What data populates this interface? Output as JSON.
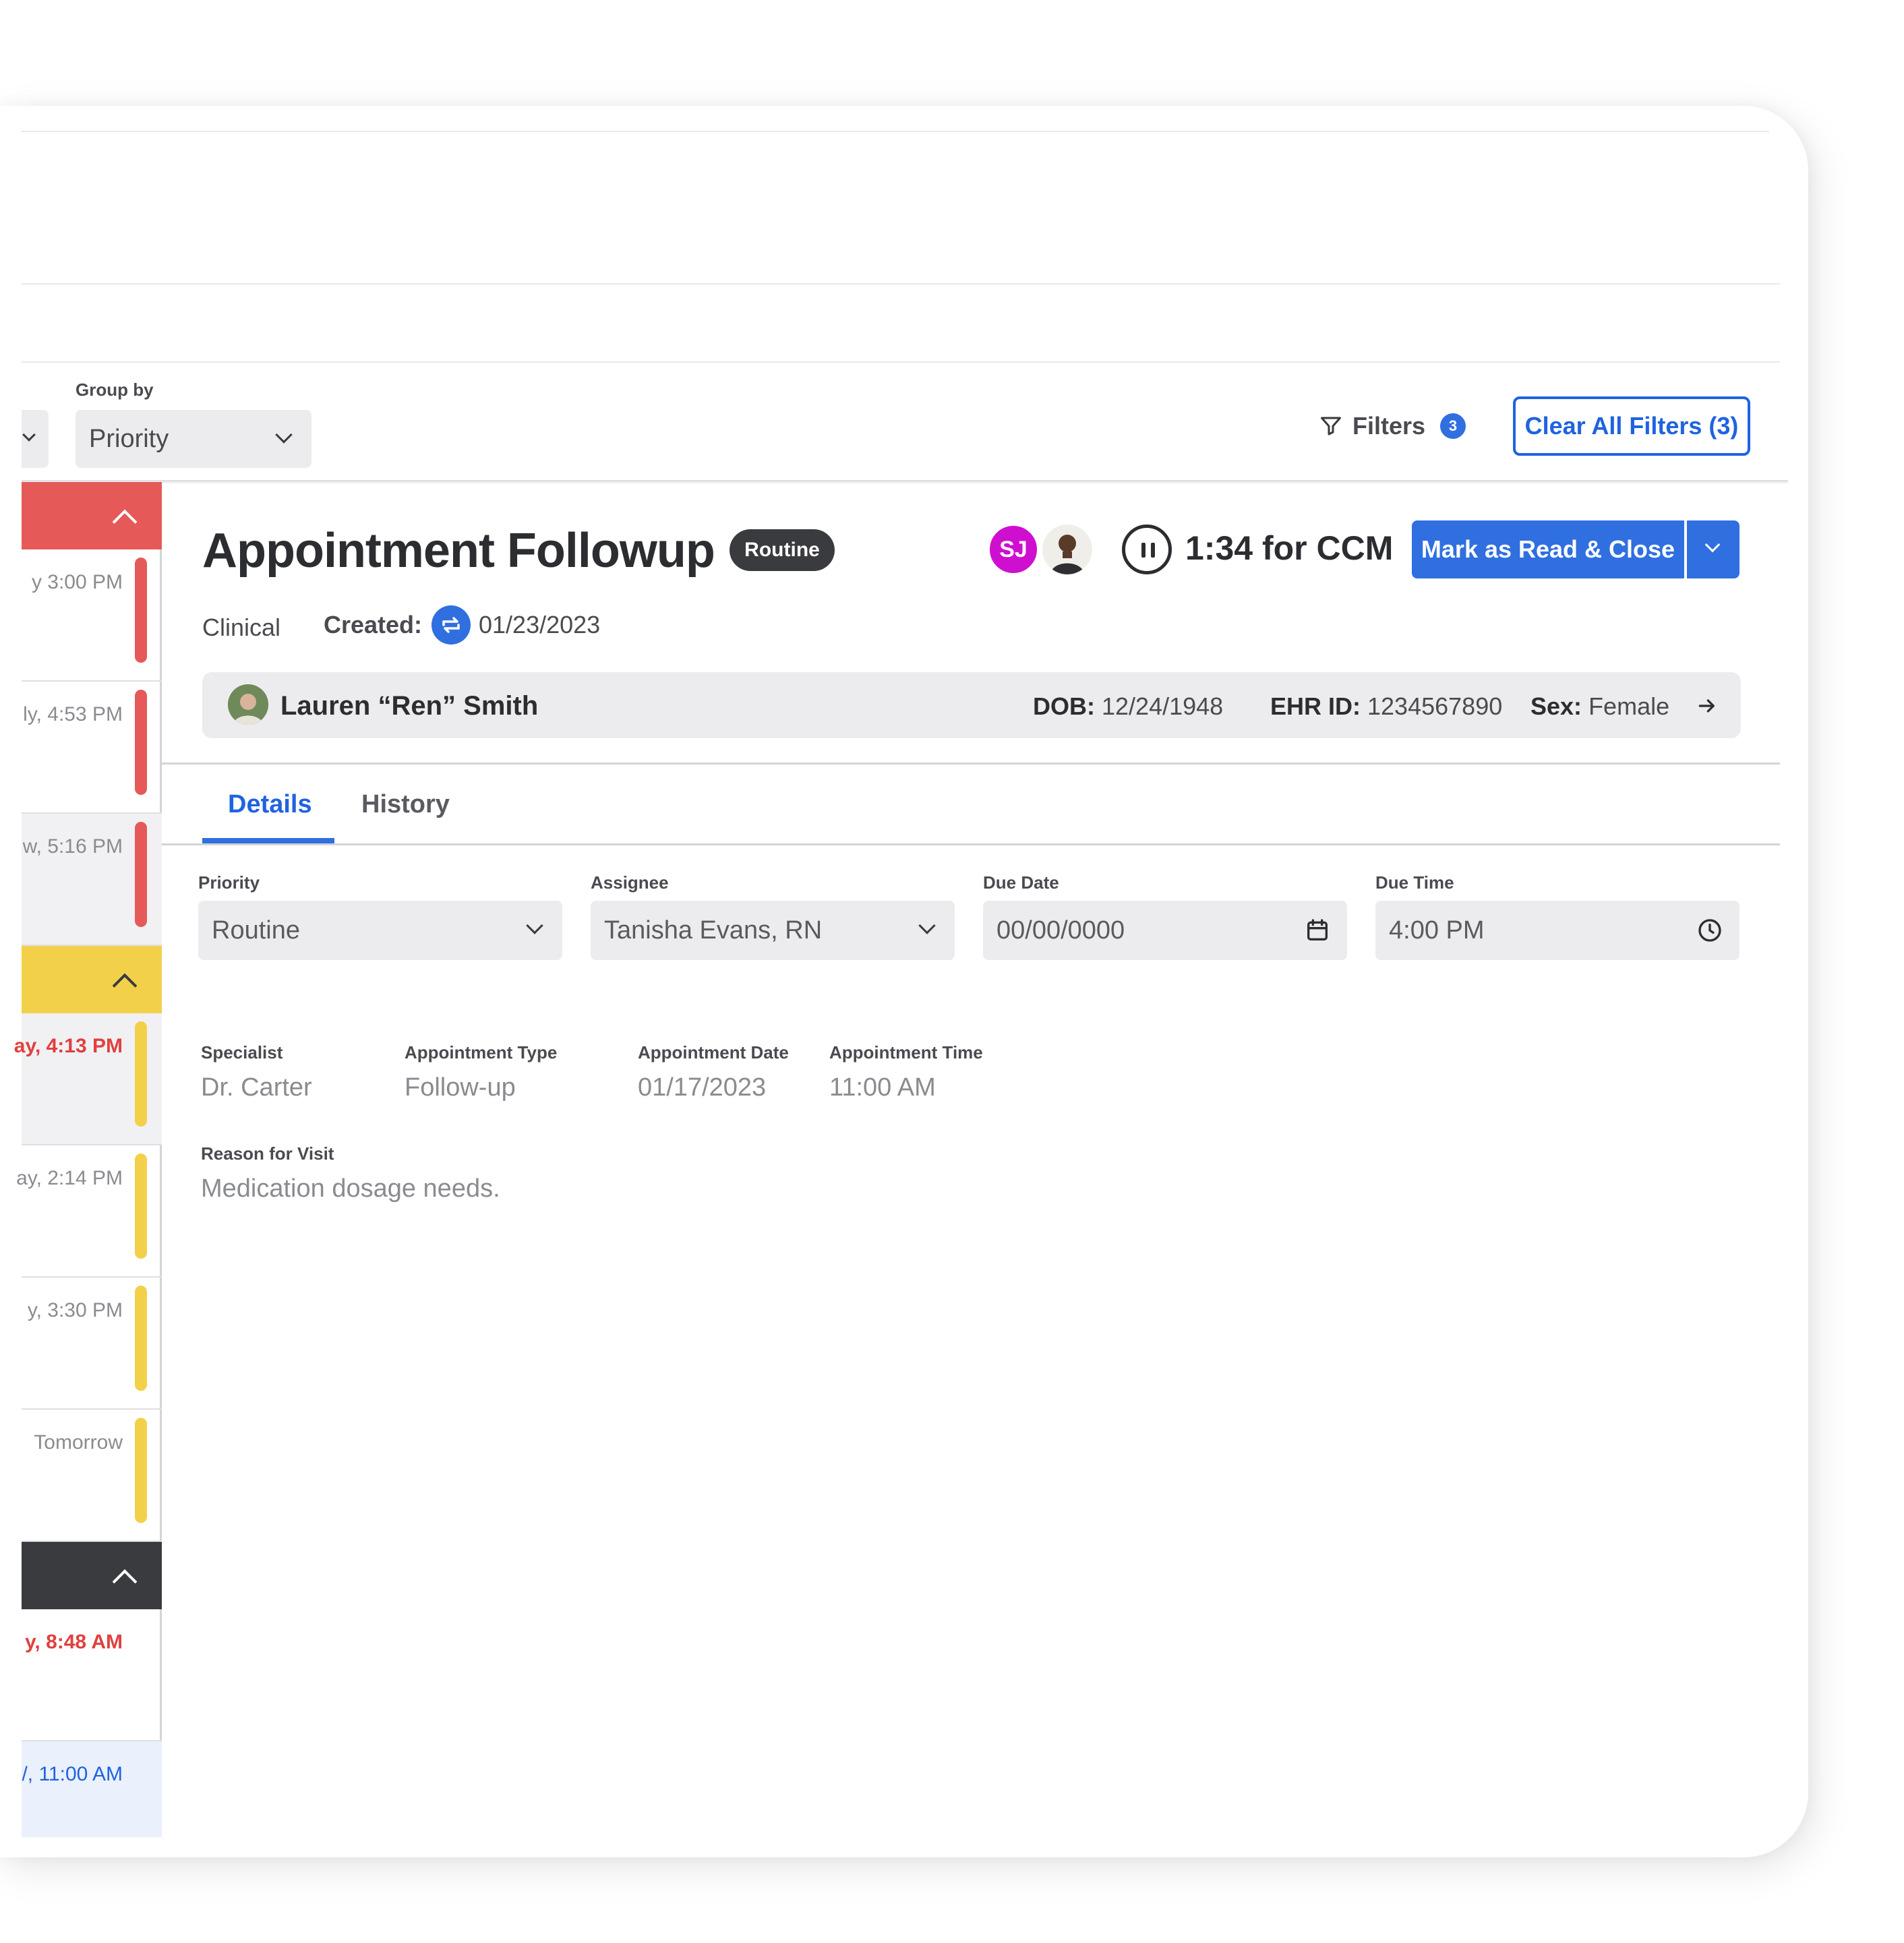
{
  "toolbar": {
    "group_by_label": "Group by",
    "group_by_value": "Priority",
    "filters_label": "Filters",
    "filters_count": "3",
    "clear_filters_label": "Clear All Filters (3)"
  },
  "colors": {
    "accent": "#2f6fe0",
    "urgent": "#e55a58",
    "high": "#f3d04a",
    "low": "#3a3b3f"
  },
  "list": {
    "groups": [
      {
        "color": "urgent",
        "icon": "chevron-up-icon"
      },
      {
        "color": "high",
        "icon": "chevron-up-icon"
      },
      {
        "color": "low",
        "icon": "chevron-up-icon"
      }
    ],
    "items": [
      {
        "time": "y 3:00 PM",
        "status": "normal",
        "bar": "#e55a58"
      },
      {
        "time": "ly, 4:53 PM",
        "status": "normal",
        "bar": "#e55a58"
      },
      {
        "time": "w, 5:16 PM",
        "status": "normal",
        "bar": "#e55a58"
      },
      {
        "time": "ay, 4:13 PM",
        "status": "overdue",
        "bar": "#f3d04a"
      },
      {
        "time": "ay, 2:14 PM",
        "status": "normal",
        "bar": "#f3d04a"
      },
      {
        "time": "y, 3:30 PM",
        "status": "normal",
        "bar": "#f3d04a"
      },
      {
        "time": "Tomorrow",
        "status": "normal",
        "bar": "#f3d04a"
      },
      {
        "time": "y, 8:48 AM",
        "status": "overdue",
        "bar": ""
      },
      {
        "time": "/, 11:00 AM",
        "status": "active",
        "bar": ""
      }
    ]
  },
  "task": {
    "title": "Appointment Followup",
    "priority_badge": "Routine",
    "avatar_initials": "SJ",
    "timer": "1:34 for CCM",
    "primary_action": "Mark as Read & Close",
    "category": "Clinical",
    "created_label": "Created:",
    "created_date": "01/23/2023"
  },
  "patient": {
    "name": "Lauren “Ren” Smith",
    "dob_label": "DOB:",
    "dob": "12/24/1948",
    "ehr_label": "EHR ID:",
    "ehr_id": "1234567890",
    "sex_label": "Sex:",
    "sex": "Female"
  },
  "tabs": [
    {
      "label": "Details",
      "active": true
    },
    {
      "label": "History",
      "active": false
    }
  ],
  "fields": {
    "priority": {
      "label": "Priority",
      "value": "Routine"
    },
    "assignee": {
      "label": "Assignee",
      "value": "Tanisha Evans, RN"
    },
    "due_date": {
      "label": "Due Date",
      "value": "00/00/0000"
    },
    "due_time": {
      "label": "Due Time",
      "value": "4:00 PM"
    }
  },
  "appointment": {
    "specialist_label": "Specialist",
    "specialist": "Dr. Carter",
    "type_label": "Appointment Type",
    "type": "Follow-up",
    "date_label": "Appointment Date",
    "date": "01/17/2023",
    "time_label": "Appointment Time",
    "time": "11:00 AM",
    "reason_label": "Reason for Visit",
    "reason": "Medication dosage needs."
  }
}
